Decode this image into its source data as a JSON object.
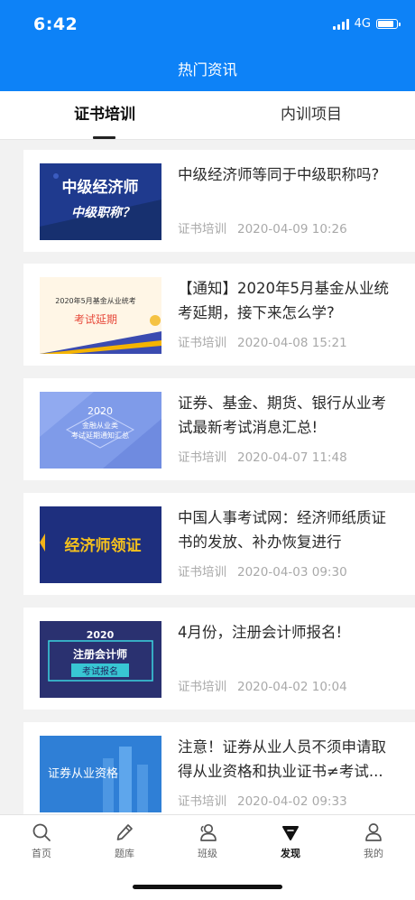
{
  "status": {
    "time": "6:42",
    "network": "4G"
  },
  "nav": {
    "title": "热门资讯"
  },
  "tabs": [
    {
      "label": "证书培训",
      "active": true
    },
    {
      "label": "内训项目",
      "active": false
    }
  ],
  "articles": [
    {
      "title_lines": [
        "中级经济师等同于中级职称吗?"
      ],
      "category": "证书培训",
      "date": "2020-04-09 10:26",
      "thumb": {
        "lines": [
          "中级经济师",
          "中级职称？"
        ],
        "bg": "#1f3a8e"
      }
    },
    {
      "title_lines": [
        "【通知】2020年5月基金从业统",
        "考延期，接下来怎么学?"
      ],
      "category": "证书培训",
      "date": "2020-04-08 15:21",
      "thumb": {
        "lines": [
          "2020年5月基金从业统考",
          "考试延期"
        ],
        "bg": "#fff6e6"
      }
    },
    {
      "title_lines": [
        "证券、基金、期货、银行从业考",
        "试最新考试消息汇总!"
      ],
      "category": "证书培训",
      "date": "2020-04-07 11:48",
      "thumb": {
        "lines": [
          "2020",
          "金融从业类",
          "考试延期通知汇总"
        ],
        "bg": "#7f9be9"
      }
    },
    {
      "title_lines": [
        "中国人事考试网：经济师纸质证",
        "书的发放、补办恢复进行"
      ],
      "category": "证书培训",
      "date": "2020-04-03 09:30",
      "thumb": {
        "lines": [
          "经济师领证"
        ],
        "bg": "#1e2f7e"
      }
    },
    {
      "title_lines": [
        "4月份，注册会计师报名!"
      ],
      "category": "证书培训",
      "date": "2020-04-02 10:04",
      "thumb": {
        "lines": [
          "2020",
          "注册会计师",
          "考试报名"
        ],
        "bg": "#2a3170"
      }
    },
    {
      "title_lines": [
        "注意！证券从业人员不须申请取",
        "得从业资格和执业证书≠考试..."
      ],
      "category": "证书培训",
      "date": "2020-04-02 09:33",
      "thumb": {
        "lines": [
          "证券从业资格"
        ],
        "bg": "#2f7fd6"
      }
    }
  ],
  "bottom_nav": [
    {
      "label": "首页",
      "icon": "search-icon"
    },
    {
      "label": "题库",
      "icon": "pencil-icon"
    },
    {
      "label": "班级",
      "icon": "group-icon"
    },
    {
      "label": "发现",
      "icon": "discover-icon",
      "active": true
    },
    {
      "label": "我的",
      "icon": "profile-icon"
    }
  ],
  "colors": {
    "brand": "#0d82f7",
    "meta": "#a9a9a9"
  }
}
